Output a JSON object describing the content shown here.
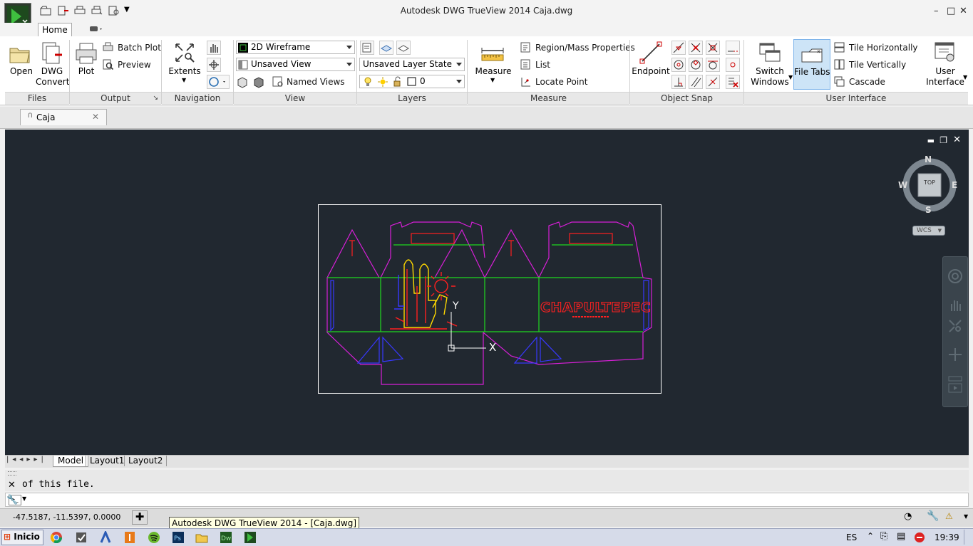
{
  "window": {
    "title": "Autodesk DWG TrueView 2014    Caja.dwg",
    "controls": {
      "minimize": "–",
      "restore": "□",
      "close": "✕"
    }
  },
  "ribbon_tabs": {
    "home": "Home"
  },
  "ribbon": {
    "files": {
      "label": "Files",
      "open": "Open",
      "dwg_convert_1": "DWG",
      "dwg_convert_2": "Convert"
    },
    "output": {
      "label": "Output",
      "plot": "Plot",
      "batch_plot": "Batch Plot",
      "preview": "Preview"
    },
    "navigation": {
      "label": "Navigation",
      "extents": "Extents"
    },
    "view": {
      "label": "View",
      "visual_style": "2D Wireframe",
      "saved_view": "Unsaved View",
      "named_views": "Named Views"
    },
    "layers": {
      "label": "Layers",
      "layer_state": "Unsaved Layer State",
      "current_layer": "0"
    },
    "measure": {
      "label": "Measure",
      "measure": "Measure",
      "region_mass": "Region/Mass Properties",
      "list": "List",
      "locate_point": "Locate Point"
    },
    "object_snap": {
      "label": "Object Snap",
      "endpoint": "Endpoint"
    },
    "user_interface": {
      "label": "User Interface",
      "switch_1": "Switch",
      "switch_2": "Windows",
      "file_tabs": "File Tabs",
      "tile_h": "Tile Horizontally",
      "tile_v": "Tile Vertically",
      "cascade": "Cascade",
      "ui_1": "User",
      "ui_2": "Interface"
    }
  },
  "file_tab": {
    "name": "Caja"
  },
  "viewcube": {
    "n": "N",
    "s": "S",
    "e": "E",
    "w": "W",
    "top": "TOP",
    "wcs": "WCS"
  },
  "ucs": {
    "x": "X",
    "y": "Y"
  },
  "drawing": {
    "brand_text": "CHAPULTEPEC"
  },
  "layout_tabs": [
    "Model",
    "Layout1",
    "Layout2"
  ],
  "command": {
    "history": "of this file."
  },
  "status": {
    "coords": "-47.5187, -11.5397, 0.0000"
  },
  "tooltip": "Autodesk DWG TrueView 2014 - [Caja.dwg]",
  "taskbar": {
    "start": "Inicio",
    "lang": "ES",
    "time": "19:39"
  },
  "colors": {
    "canvas": "#212830",
    "magenta": "#d81fd8",
    "green": "#1fd81f",
    "red": "#ff2020",
    "blue": "#3838ff",
    "yellow": "#ffd800"
  }
}
